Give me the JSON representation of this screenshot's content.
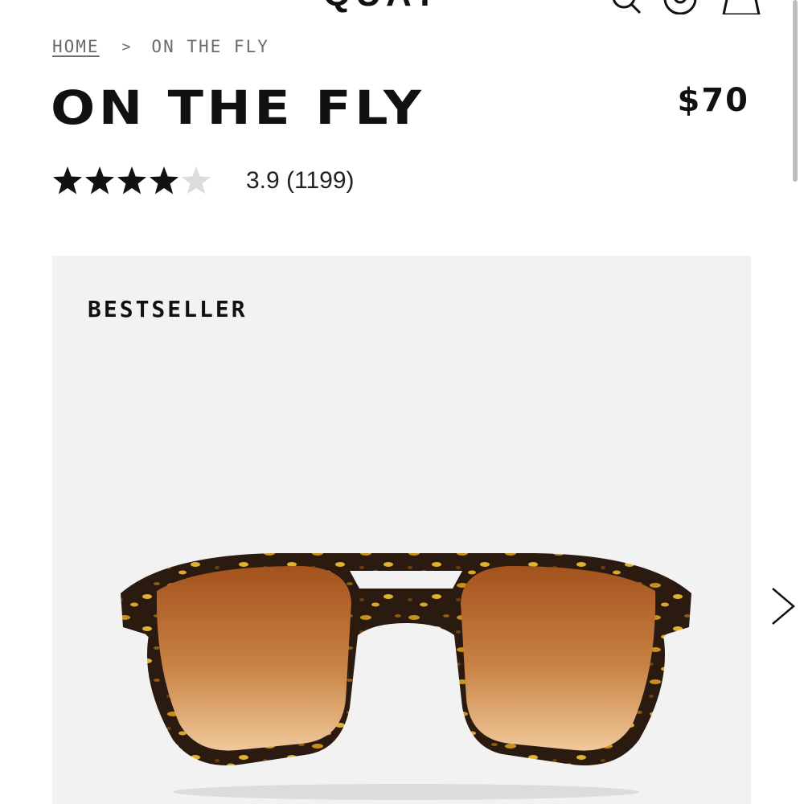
{
  "header": {
    "logo_text": "QUAY",
    "icons": [
      "search-icon",
      "account-icon",
      "bag-icon"
    ]
  },
  "breadcrumb": {
    "home": "HOME",
    "separator": ">",
    "current": "ON THE FLY"
  },
  "product": {
    "title": "ON THE FLY",
    "price": "$70",
    "rating": {
      "value": 3.9,
      "stars_filled": 4,
      "stars_total": 5,
      "text": "3.9 (1199)"
    },
    "badge": "BESTSELLER"
  },
  "carousel": {
    "next_icon": "chevron-right-icon"
  },
  "colors": {
    "card_bg": "#f2f2f2",
    "text": "#111111",
    "muted": "#6b6b6b",
    "lens": "#b5622a",
    "frame_tortoise": "#2a1a10"
  }
}
